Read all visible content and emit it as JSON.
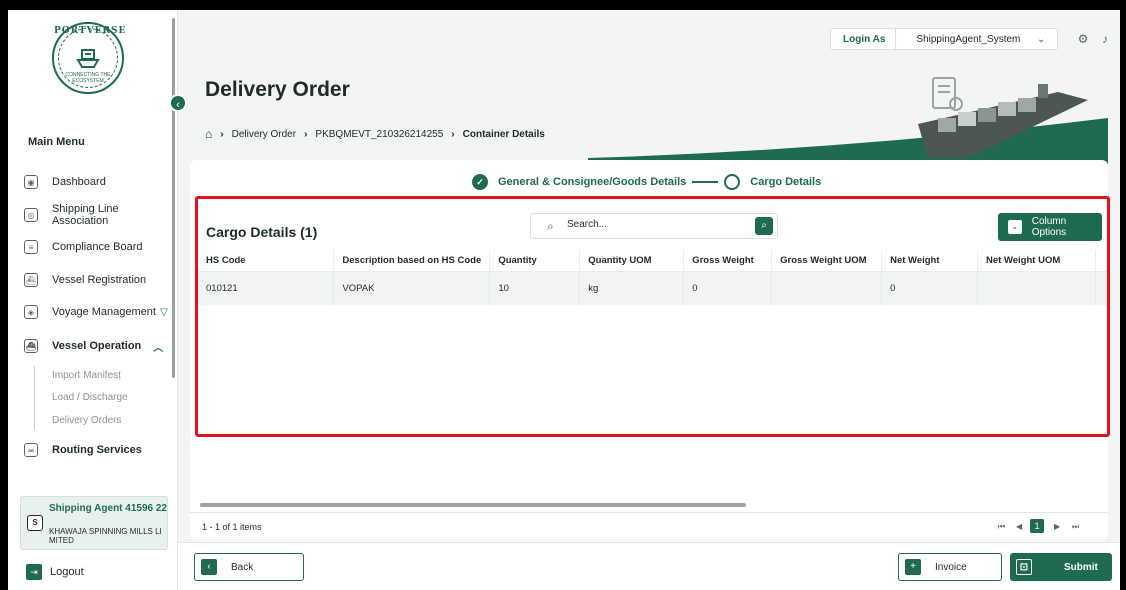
{
  "colors": {
    "brand": "#1e6b50",
    "highlight": "#e0121b"
  },
  "logo": {
    "text": "PORTVERSE",
    "tagline": "CONNECTING THE ECOSYSTEM"
  },
  "sidebar": {
    "heading": "Main Menu",
    "items": [
      {
        "label": "Dashboard",
        "icon": "dashboard-icon"
      },
      {
        "label": "Shipping Line Association",
        "icon": "association-icon"
      },
      {
        "label": "Compliance Board",
        "icon": "clipboard-icon"
      },
      {
        "label": "Vessel Registration",
        "icon": "ship-icon"
      },
      {
        "label": "Voyage Management",
        "icon": "voyage-icon"
      },
      {
        "label": "Vessel Operation",
        "icon": "ship-icon"
      },
      {
        "label": "Routing Services",
        "icon": "routing-icon"
      }
    ],
    "subitems": [
      "Import Manifest",
      "Load / Discharge",
      "Delivery Orders"
    ],
    "agent": {
      "avatar": "S",
      "name": "Shipping Agent 41596 22",
      "company": "KHAWAJA SPINNING MILLS LI MITED"
    },
    "logout": "Logout"
  },
  "topbar": {
    "login_label": "Login As",
    "login_value": "ShippingAgent_System"
  },
  "header": {
    "title": "Delivery Order",
    "breadcrumb": [
      "Delivery Order",
      "PKBQMEVT_210326214255",
      "Container Details"
    ]
  },
  "stepper": {
    "step1": "General & Consignee/Goods Details",
    "step2": "Cargo Details"
  },
  "grid": {
    "title": "Cargo Details (1)",
    "search_placeholder": "Search...",
    "column_options": "Column Options",
    "columns": [
      "HS Code",
      "Description based on HS Code",
      "Quantity",
      "Quantity UOM",
      "Gross Weight",
      "Gross Weight UOM",
      "Net Weight",
      "Net Weight UOM"
    ],
    "rows": [
      [
        "010121",
        "VOPAK",
        "10",
        "kg",
        "0",
        "",
        "0",
        ""
      ]
    ],
    "pager_info": "1 - 1 of 1 items",
    "current_page": "1"
  },
  "footer": {
    "back": "Back",
    "invoice": "Invoice",
    "submit": "Submit"
  }
}
